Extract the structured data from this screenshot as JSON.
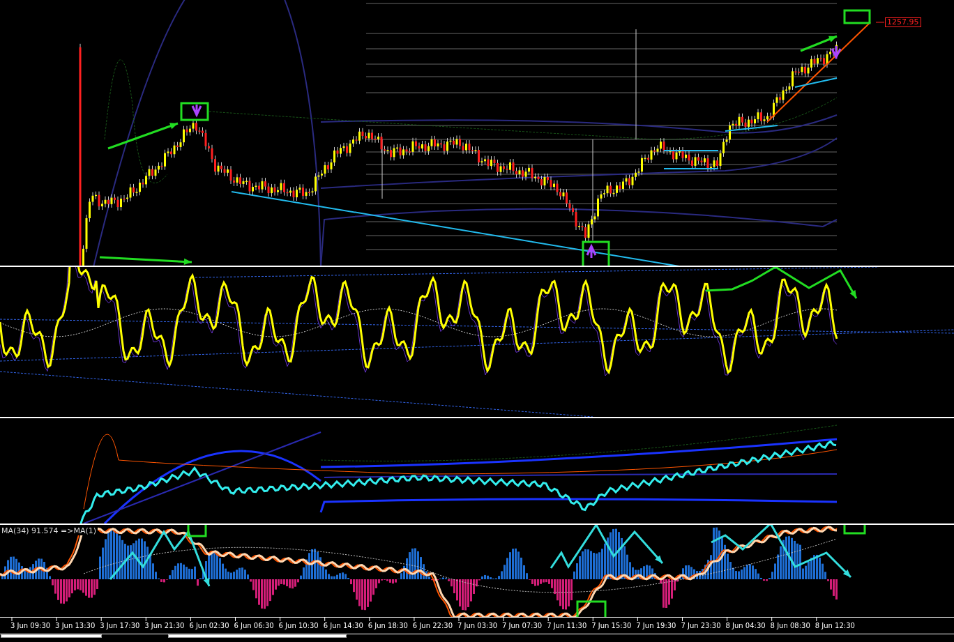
{
  "price_panel": {
    "price_label": "1257.95"
  },
  "indicator_panel": {
    "label": "MA(34) 91.574  =>MA(1)"
  },
  "time_axis": {
    "labels": [
      "3 Jun 09:30",
      "3 Jun 13:30",
      "3 Jun 17:30",
      "3 Jun 21:30",
      "6 Jun 02:30",
      "6 Jun 06:30",
      "6 Jun 10:30",
      "6 Jun 14:30",
      "6 Jun 18:30",
      "6 Jun 22:30",
      "7 Jun 03:30",
      "7 Jun 07:30",
      "7 Jun 11:30",
      "7 Jun 15:30",
      "7 Jun 19:30",
      "7 Jun 23:30",
      "8 Jun 04:30",
      "8 Jun 08:30",
      "8 Jun 12:30"
    ]
  }
}
